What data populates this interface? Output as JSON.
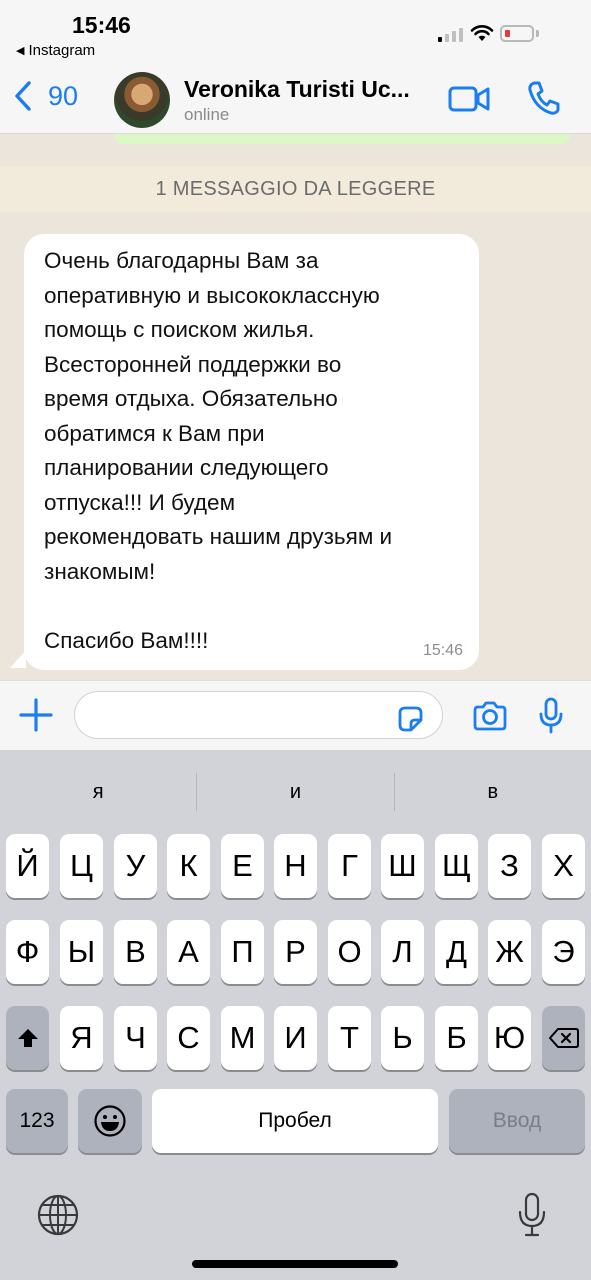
{
  "status_bar": {
    "time": "15:46",
    "back_app": "Instagram"
  },
  "header": {
    "back_count": "90",
    "contact_name": "Veronika Turisti Uc...",
    "contact_status": "online"
  },
  "chat": {
    "unread_banner": "1 MESSAGGIO DA LEGGERE",
    "message": {
      "text": "Очень благодарны Вам за\nоперативную и высококлассную\nпомощь с поиском жилья.\nВсесторонней поддержки во\nвремя отдыха. Обязательно\nобратимся к Вам при\nпланировании следующего\nотпуска!!! И будем\nрекомендовать нашим друзьям и\nзнакомым!\n\nСпасибо Вам!!!!",
      "time": "15:46"
    }
  },
  "colors": {
    "accent": "#1a7ef0",
    "chat_bg": "#ece5dc",
    "outgoing_bubble": "#dcf8c6",
    "incoming_bubble": "#ffffff"
  },
  "keyboard": {
    "suggestions": [
      "я",
      "и",
      "в"
    ],
    "row1": [
      "Й",
      "Ц",
      "У",
      "К",
      "Е",
      "Н",
      "Г",
      "Ш",
      "Щ",
      "З",
      "Х"
    ],
    "row2": [
      "Ф",
      "Ы",
      "В",
      "А",
      "П",
      "Р",
      "О",
      "Л",
      "Д",
      "Ж",
      "Э"
    ],
    "row3": [
      "Я",
      "Ч",
      "С",
      "М",
      "И",
      "Т",
      "Ь",
      "Б",
      "Ю"
    ],
    "numbers_key": "123",
    "space_key": "Пробел",
    "return_key": "Ввод",
    "icons": {
      "shift": "shift-icon",
      "backspace": "backspace-icon",
      "emoji": "emoji-icon",
      "globe": "globe-icon",
      "dictation": "microphone-icon"
    }
  }
}
